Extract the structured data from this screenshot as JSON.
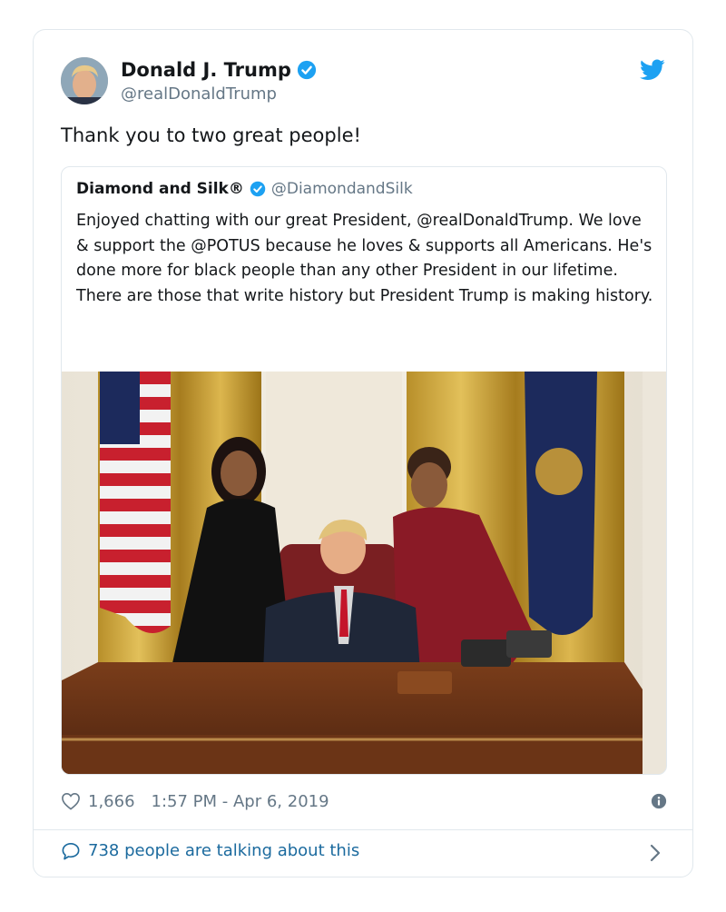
{
  "tweet": {
    "author_name": "Donald J. Trump",
    "author_handle": "@realDonaldTrump",
    "text": "Thank you to two great people!",
    "likes": "1,666",
    "timestamp": "1:57 PM - Apr 6, 2019",
    "conversation": "738 people are talking about this"
  },
  "quoted": {
    "author_name": "Diamond and Silk®",
    "author_handle": "@DiamondandSilk",
    "text": "Enjoyed chatting with our great President, @realDonaldTrump. We love & support the @POTUS because he loves & supports all Americans. He's done more for black people than any other President in our lifetime. There are those that write history but President Trump is making history."
  },
  "icons": {
    "verified": "verified-badge-icon",
    "twitter": "twitter-bird-icon",
    "like": "heart-icon",
    "info": "info-icon",
    "reply": "speech-bubble-icon",
    "next": "chevron-right-icon"
  },
  "colors": {
    "twitter_blue": "#1da1f2",
    "link_blue": "#1b6a9e",
    "secondary_text": "#657786",
    "border": "#e1e8ed"
  }
}
